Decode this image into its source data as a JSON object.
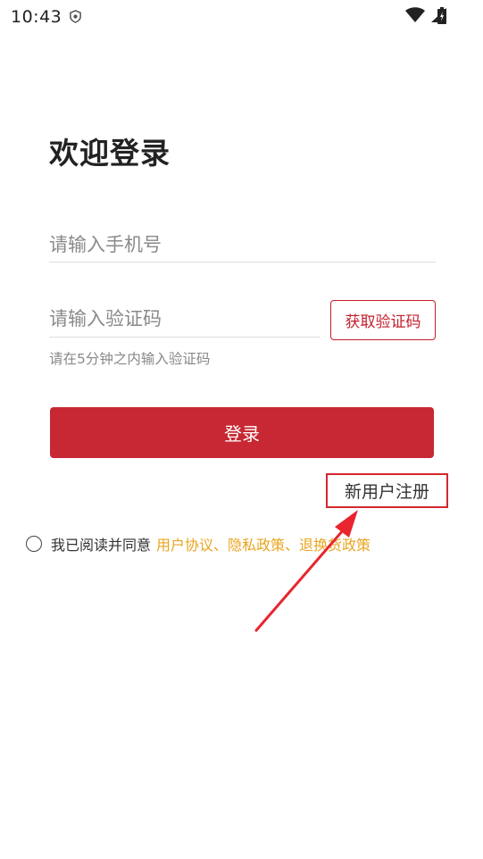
{
  "status_bar": {
    "time": "10:43"
  },
  "login": {
    "title": "欢迎登录",
    "phone_placeholder": "请输入手机号",
    "code_placeholder": "请输入验证码",
    "get_code_label": "获取验证码",
    "code_hint": "请在5分钟之内输入验证码",
    "login_label": "登录",
    "register_label": "新用户注册",
    "agree_text": "我已阅读并同意",
    "agree_links": "用户协议、隐私政策、退换货政策"
  },
  "colors": {
    "accent": "#c72833",
    "link": "#e8a520",
    "annotation": "#e8252e"
  },
  "icons": [
    "shield-icon",
    "wifi-icon",
    "signal-icon",
    "battery-icon",
    "annotation-arrow"
  ]
}
